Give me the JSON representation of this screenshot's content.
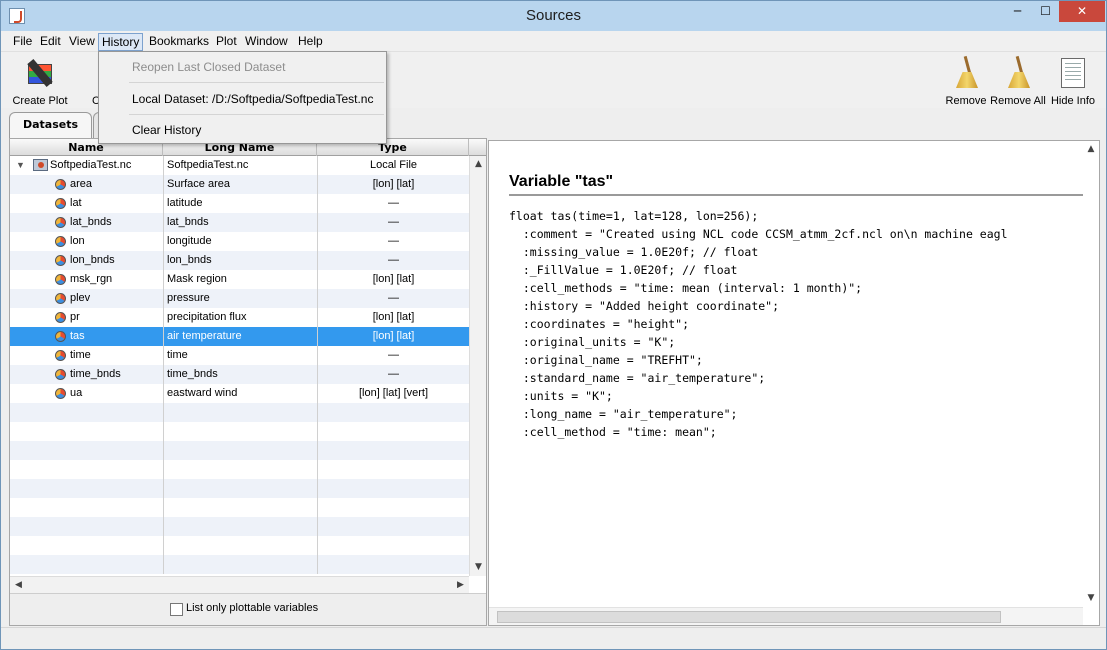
{
  "window": {
    "title": "Sources"
  },
  "menubar": [
    "File",
    "Edit",
    "View",
    "History",
    "Bookmarks",
    "Plot",
    "Window",
    "Help"
  ],
  "history_menu": {
    "items": [
      {
        "label": "Reopen Last Closed Dataset",
        "enabled": false
      },
      {
        "label": "Local Dataset: /D:/Softpedia/SoftpediaTest.nc",
        "enabled": true
      },
      {
        "label": "Clear History",
        "enabled": true
      }
    ]
  },
  "toolbar": {
    "create_plot": "Create Plot",
    "partial_label": "C",
    "remove": "Remove",
    "remove_all": "Remove All",
    "hide_info": "Hide Info"
  },
  "tabs": {
    "datasets": "Datasets"
  },
  "table": {
    "headers": [
      "Name",
      "Long Name",
      "Type"
    ],
    "dataset": {
      "name": "SoftpediaTest.nc",
      "long_name": "SoftpediaTest.nc",
      "type": "Local File"
    },
    "rows": [
      {
        "name": "area",
        "long_name": "Surface area",
        "type": "[lon] [lat]"
      },
      {
        "name": "lat",
        "long_name": "latitude",
        "type": "—"
      },
      {
        "name": "lat_bnds",
        "long_name": "lat_bnds",
        "type": "—"
      },
      {
        "name": "lon",
        "long_name": "longitude",
        "type": "—"
      },
      {
        "name": "lon_bnds",
        "long_name": "lon_bnds",
        "type": "—"
      },
      {
        "name": "msk_rgn",
        "long_name": "Mask region",
        "type": "[lon] [lat]"
      },
      {
        "name": "plev",
        "long_name": "pressure",
        "type": "—"
      },
      {
        "name": "pr",
        "long_name": "precipitation flux",
        "type": "[lon] [lat]"
      },
      {
        "name": "tas",
        "long_name": "air temperature",
        "type": "[lon] [lat]"
      },
      {
        "name": "time",
        "long_name": "time",
        "type": "—"
      },
      {
        "name": "time_bnds",
        "long_name": "time_bnds",
        "type": "—"
      },
      {
        "name": "ua",
        "long_name": "eastward wind",
        "type": "[lon] [lat] [vert]"
      }
    ],
    "selected_index": 8
  },
  "footer": {
    "checkbox_label": "List only plottable variables"
  },
  "info": {
    "title": "Variable \"tas\"",
    "lines": [
      "float tas(time=1, lat=128, lon=256);",
      "  :comment = \"Created using NCL code CCSM_atmm_2cf.ncl on\\n machine eagl",
      "  :missing_value = 1.0E20f; // float",
      "  :_FillValue = 1.0E20f; // float",
      "  :cell_methods = \"time: mean (interval: 1 month)\";",
      "  :history = \"Added height coordinate\";",
      "  :coordinates = \"height\";",
      "  :original_units = \"K\";",
      "  :original_name = \"TREFHT\";",
      "  :standard_name = \"air_temperature\";",
      "  :units = \"K\";",
      "  :long_name = \"air_temperature\";",
      "  :cell_method = \"time: mean\";"
    ]
  }
}
